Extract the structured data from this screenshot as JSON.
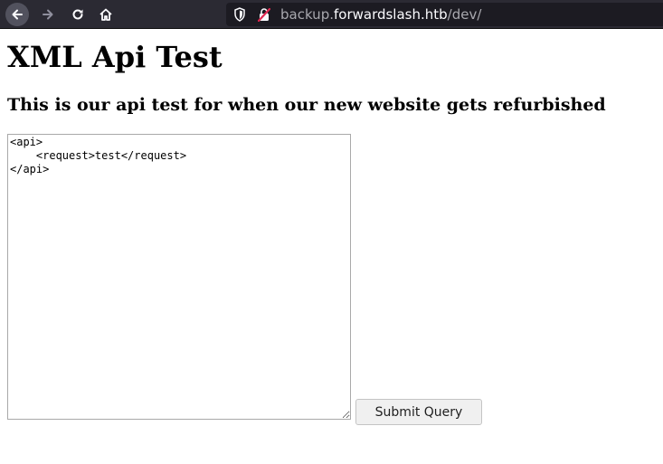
{
  "browser": {
    "url_scheme_part": "backup.",
    "url_host": "forwardslash.htb",
    "url_path": "/dev/",
    "icons": [
      "back-arrow-icon",
      "forward-arrow-icon",
      "reload-icon",
      "home-icon",
      "shield-icon",
      "insecure-lock-icon"
    ]
  },
  "page": {
    "title": "XML Api Test",
    "subtitle": "This is our api test for when our new website gets refurbished",
    "xml_input_value": "<api>\n    <request>test</request>\n</api>",
    "submit_label": "Submit Query"
  },
  "colors": {
    "toolbar_bg": "#2b2a33",
    "urlbar_bg": "#1c1b22",
    "insecure_lock": "#e22850"
  }
}
